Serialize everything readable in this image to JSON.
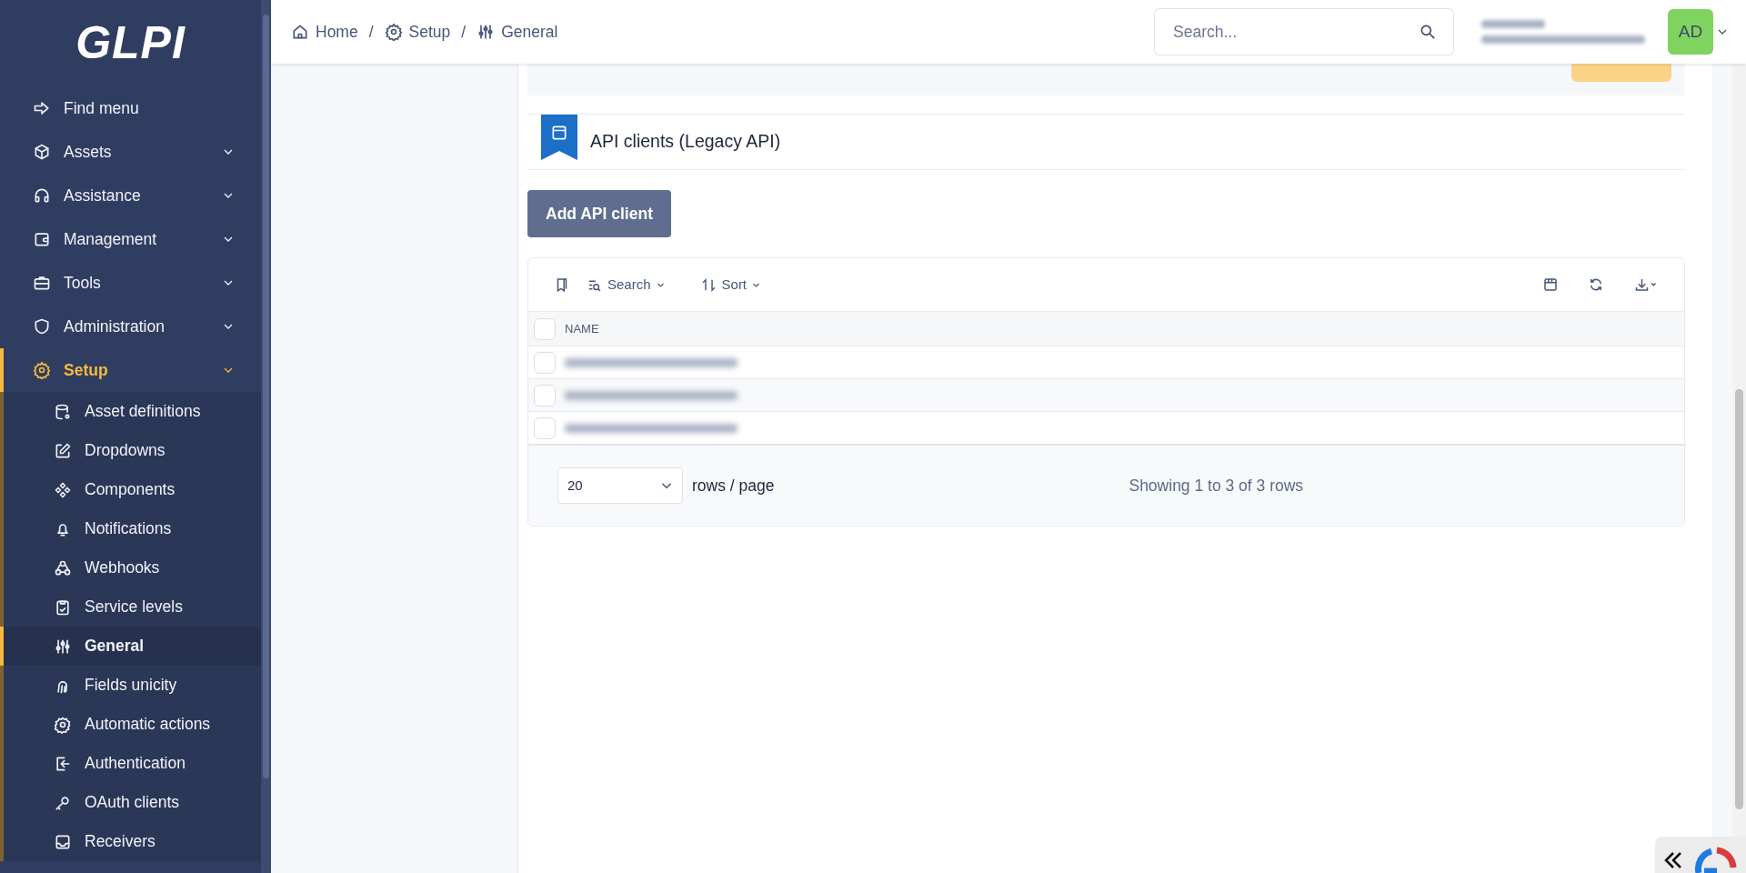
{
  "logo": {
    "text": "GLPI"
  },
  "sidebar": {
    "items": [
      {
        "label": "Find menu",
        "kind": "action",
        "selected": false
      },
      {
        "label": "Assets",
        "kind": "menu",
        "selected": false
      },
      {
        "label": "Assistance",
        "kind": "menu",
        "selected": false
      },
      {
        "label": "Management",
        "kind": "menu",
        "selected": false
      },
      {
        "label": "Tools",
        "kind": "menu",
        "selected": false
      },
      {
        "label": "Administration",
        "kind": "menu",
        "selected": false
      },
      {
        "label": "Setup",
        "kind": "menu",
        "selected": true,
        "children": [
          {
            "label": "Asset definitions",
            "selected": false
          },
          {
            "label": "Dropdowns",
            "selected": false
          },
          {
            "label": "Components",
            "selected": false
          },
          {
            "label": "Notifications",
            "selected": false
          },
          {
            "label": "Webhooks",
            "selected": false
          },
          {
            "label": "Service levels",
            "selected": false
          },
          {
            "label": "General",
            "selected": true
          },
          {
            "label": "Fields unicity",
            "selected": false
          },
          {
            "label": "Automatic actions",
            "selected": false
          },
          {
            "label": "Authentication",
            "selected": false
          },
          {
            "label": "OAuth clients",
            "selected": false
          },
          {
            "label": "Receivers",
            "selected": false
          }
        ]
      }
    ]
  },
  "breadcrumbs": [
    "Home",
    "Setup",
    "General"
  ],
  "breadcrumb_separators": [
    "/",
    "/"
  ],
  "search": {
    "placeholder": "Search..."
  },
  "user": {
    "initials": "AD",
    "color": "#7fd35f"
  },
  "section": {
    "title": "API clients (Legacy API)"
  },
  "add_button": "Add API client",
  "toolbar": {
    "search": "Search",
    "sort": "Sort"
  },
  "table": {
    "all_checked": false,
    "columns": [
      "NAME"
    ],
    "rows": [
      {
        "checked": false
      },
      {
        "checked": false
      },
      {
        "checked": false
      }
    ]
  },
  "pager": {
    "page_size": "20",
    "page_size_label": "rows / page",
    "summary": "Showing 1 to 3 of 3 rows"
  }
}
